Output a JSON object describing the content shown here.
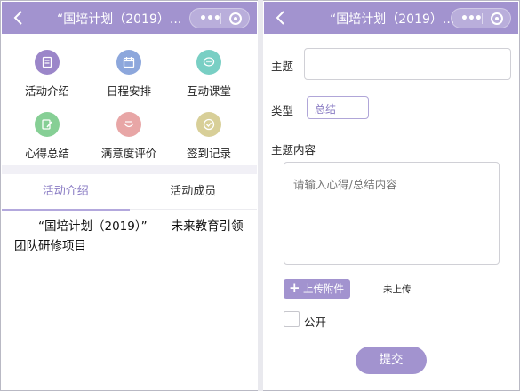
{
  "left_screen": {
    "nav_title": "“国培计划（2019）...",
    "menu": [
      {
        "label": "活动介绍",
        "icon": "document-icon",
        "color": "#9b86c9"
      },
      {
        "label": "日程安排",
        "icon": "calendar-icon",
        "color": "#8da7dc"
      },
      {
        "label": "互动课堂",
        "icon": "chat-icon",
        "color": "#79cfc4"
      },
      {
        "label": "心得总结",
        "icon": "notes-icon",
        "color": "#86cf95"
      },
      {
        "label": "满意度评价",
        "icon": "smile-icon",
        "color": "#e8a6a6"
      },
      {
        "label": "签到记录",
        "icon": "check-icon",
        "color": "#d8cf98"
      }
    ],
    "tabs": [
      {
        "label": "活动介绍"
      },
      {
        "label": "活动成员"
      }
    ],
    "intro_text": "“国培计划（2019）”——未来教育引领团队研修项目"
  },
  "right_screen": {
    "nav_title": "“国培计划（2019）...",
    "subject_label": "主题",
    "subject_value": "",
    "type_label": "类型",
    "type_value": "总结",
    "content_label": "主题内容",
    "content_placeholder": "请输入心得/总结内容",
    "upload_button": "上传附件",
    "upload_status": "未上传",
    "public_label": "公开",
    "public_checked": false,
    "submit_button": "提交"
  },
  "colors": {
    "nav_bar": "#a293cf",
    "accent": "#8a7cc4",
    "button": "#a293cf"
  }
}
